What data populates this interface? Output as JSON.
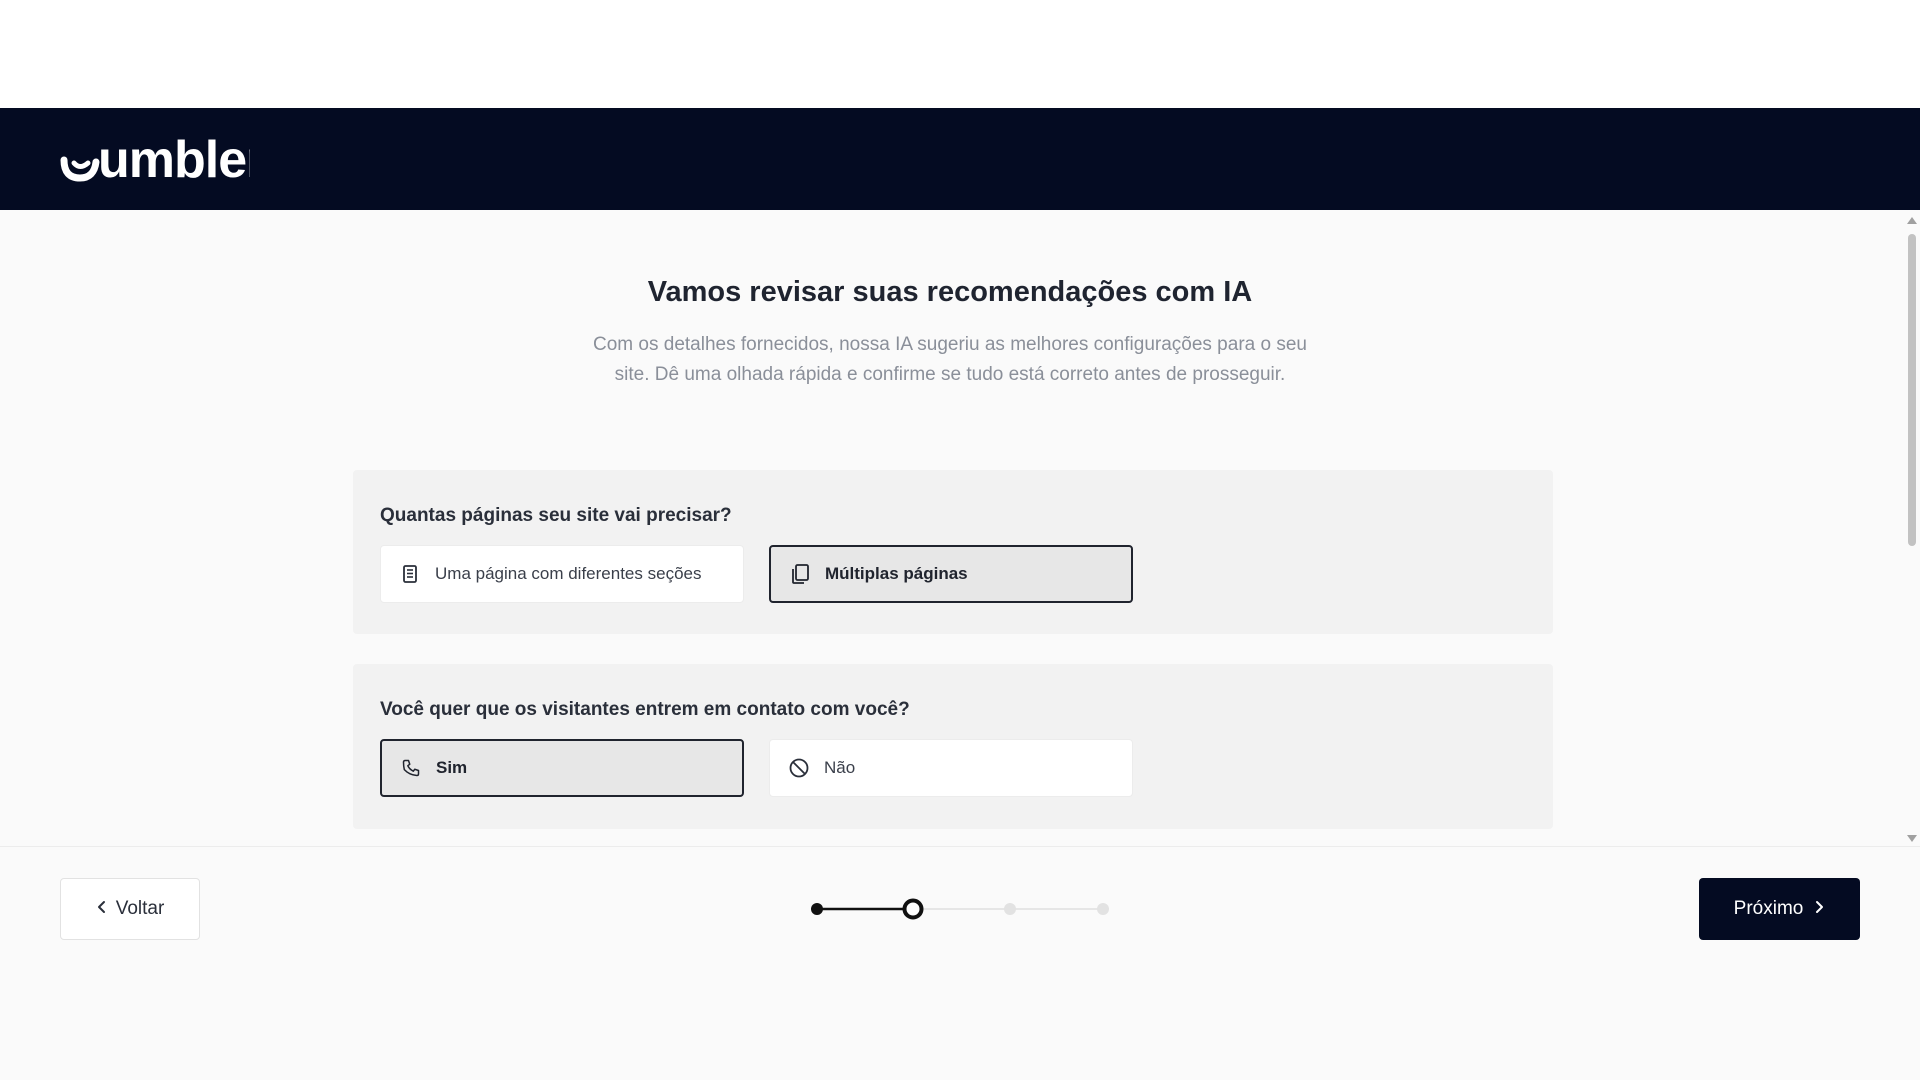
{
  "header": {
    "logo_text": "umbler"
  },
  "main": {
    "title": "Vamos revisar suas recomendações com IA",
    "subtitle": "Com os detalhes fornecidos, nossa IA sugeriu as melhores configurações para o seu site. Dê uma olhada rápida e confirme se tudo está correto antes de prosseguir.",
    "sections": [
      {
        "question": "Quantas páginas seu site vai precisar?",
        "options": [
          {
            "label": "Uma página com diferentes seções",
            "icon": "single-page-icon",
            "selected": false
          },
          {
            "label": "Múltiplas páginas",
            "icon": "multiple-pages-icon",
            "selected": true
          }
        ]
      },
      {
        "question": "Você quer que os visitantes entrem em contato com você?",
        "options": [
          {
            "label": "Sim",
            "icon": "phone-icon",
            "selected": true
          },
          {
            "label": "Não",
            "icon": "block-icon",
            "selected": false
          }
        ]
      }
    ]
  },
  "footer": {
    "back_label": "Voltar",
    "next_label": "Próximo",
    "stepper": {
      "total_steps": 4,
      "current_step": 2
    }
  },
  "colors": {
    "header_bg": "#040b22",
    "primary_button": "#040b22",
    "selected_border": "#20242e"
  }
}
